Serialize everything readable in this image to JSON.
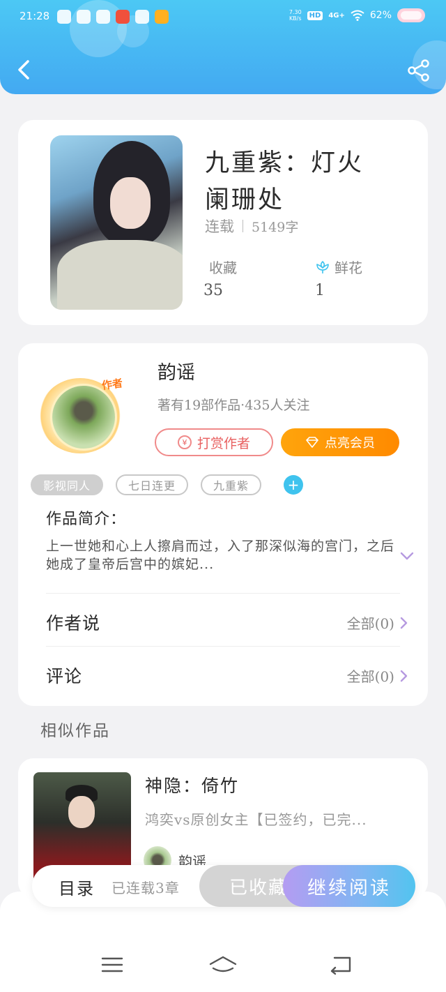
{
  "status_bar": {
    "time": "21:28",
    "net_speed_top": "7.30",
    "net_speed_unit": "KB/s",
    "hd": "HD",
    "signal": "4G+",
    "battery": "62%"
  },
  "book": {
    "title": "九重紫：灯火阑珊处",
    "status": "连载",
    "word_count": "5149字",
    "favorites_label": "收藏",
    "favorites_value": "35",
    "flowers_label": "鲜花",
    "flowers_value": "1"
  },
  "author": {
    "badge": "作者",
    "name": "韵谣",
    "info": "著有19部作品·435人关注",
    "reward_label": "打赏作者",
    "reward_icon": "¥",
    "vip_label": "点亮会员"
  },
  "tags": [
    "影视同人",
    "七日连更",
    "九重紫"
  ],
  "tag_add_symbol": "+",
  "intro": {
    "title": "作品简介：",
    "text": "上一世她和心上人擦肩而过，入了那深似海的宫门，之后她成了皇帝后宫中的嫔妃..."
  },
  "author_says": {
    "label": "作者说",
    "right": "全部(0)"
  },
  "comments": {
    "label": "评论",
    "right": "全部(0)"
  },
  "similar": {
    "section_title": "相似作品",
    "items": [
      {
        "title": "神隐：倚竹",
        "desc": "鸿奕vs原创女主【已签约，已完...",
        "author": "韵谣"
      }
    ]
  },
  "action_bar": {
    "toc_label": "目录",
    "toc_count": "已连载3章",
    "collected_label": "已收藏",
    "continue_label": "继续阅读"
  },
  "colors": {
    "header_gradient_start": "#4cc8f4",
    "header_gradient_end": "#43a9f2",
    "vip_orange": "#ff8a00",
    "reward_red": "#e86060",
    "accent_purple": "#b49cf2",
    "tag_add_blue": "#3fc3ee"
  }
}
